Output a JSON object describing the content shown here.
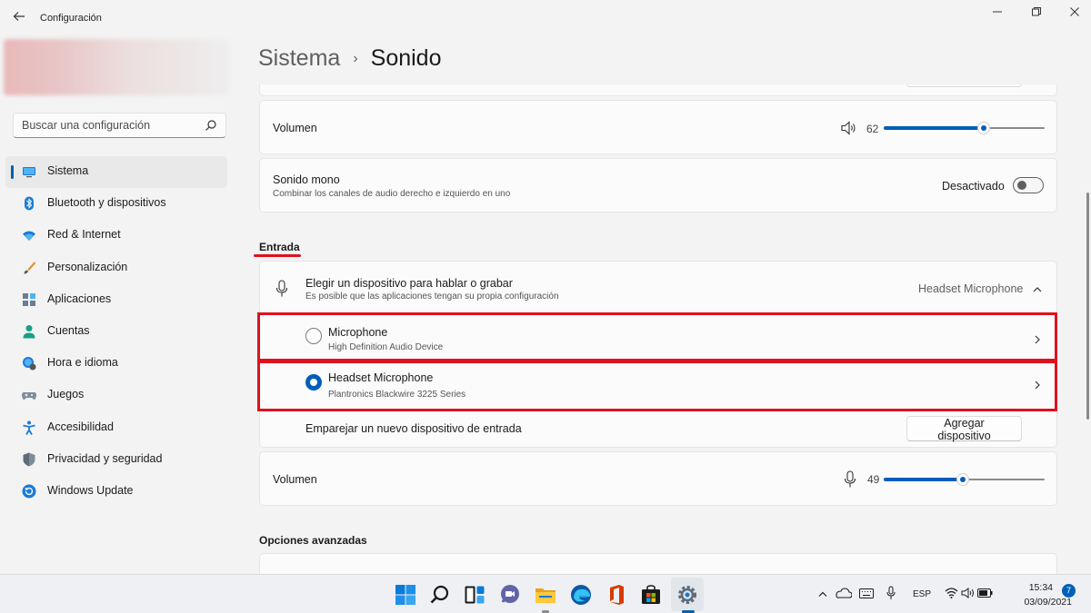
{
  "window": {
    "title": "Configuración"
  },
  "search": {
    "placeholder": "Buscar una configuración"
  },
  "sidebar": {
    "items": [
      {
        "label": "Sistema"
      },
      {
        "label": "Bluetooth y dispositivos"
      },
      {
        "label": "Red & Internet"
      },
      {
        "label": "Personalización"
      },
      {
        "label": "Aplicaciones"
      },
      {
        "label": "Cuentas"
      },
      {
        "label": "Hora e idioma"
      },
      {
        "label": "Juegos"
      },
      {
        "label": "Accesibilidad"
      },
      {
        "label": "Privacidad y seguridad"
      },
      {
        "label": "Windows Update"
      }
    ]
  },
  "breadcrumb": {
    "parent": "Sistema",
    "separator": "›",
    "current": "Sonido"
  },
  "output": {
    "volume_label": "Volumen",
    "volume_value": "62",
    "volume_level": 0.62,
    "mono_title": "Sonido mono",
    "mono_desc": "Combinar los canales de audio derecho e izquierdo en uno",
    "mono_state": "Desactivado"
  },
  "input": {
    "section_title": "Entrada",
    "choose_title": "Elegir un dispositivo para hablar o grabar",
    "choose_desc": "Es posible que las aplicaciones tengan su propia configuración",
    "selected_device": "Headset Microphone",
    "devices": [
      {
        "name": "Microphone",
        "detail": "High Definition Audio Device",
        "selected": false
      },
      {
        "name": "Headset Microphone",
        "detail": "Plantronics Blackwire 3225 Series",
        "selected": true
      }
    ],
    "pair_label": "Emparejar un nuevo dispositivo de entrada",
    "add_button": "Agregar dispositivo",
    "volume_label": "Volumen",
    "volume_value": "49",
    "volume_level": 0.49
  },
  "advanced": {
    "section_title": "Opciones avanzadas"
  },
  "taskbar": {
    "language": "ESP",
    "time": "15:34",
    "date": "03/09/2021",
    "notifications": "7"
  },
  "colors": {
    "accent": "#005fb8",
    "highlight": "#e0111e"
  }
}
